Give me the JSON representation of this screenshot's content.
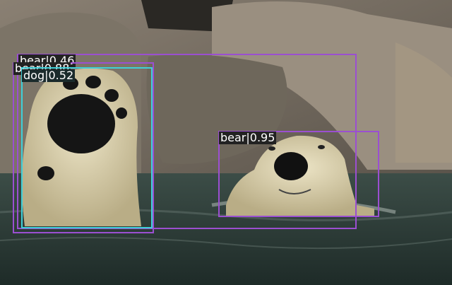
{
  "detections": [
    {
      "label": "bear|0.46",
      "color": "#9b4fd1"
    },
    {
      "label": "bear|0.88",
      "color": "#9b4fd1"
    },
    {
      "label": "dog|0.52",
      "color": "#3fd0d8"
    },
    {
      "label": "bear|0.95",
      "color": "#9b4fd1"
    }
  ]
}
